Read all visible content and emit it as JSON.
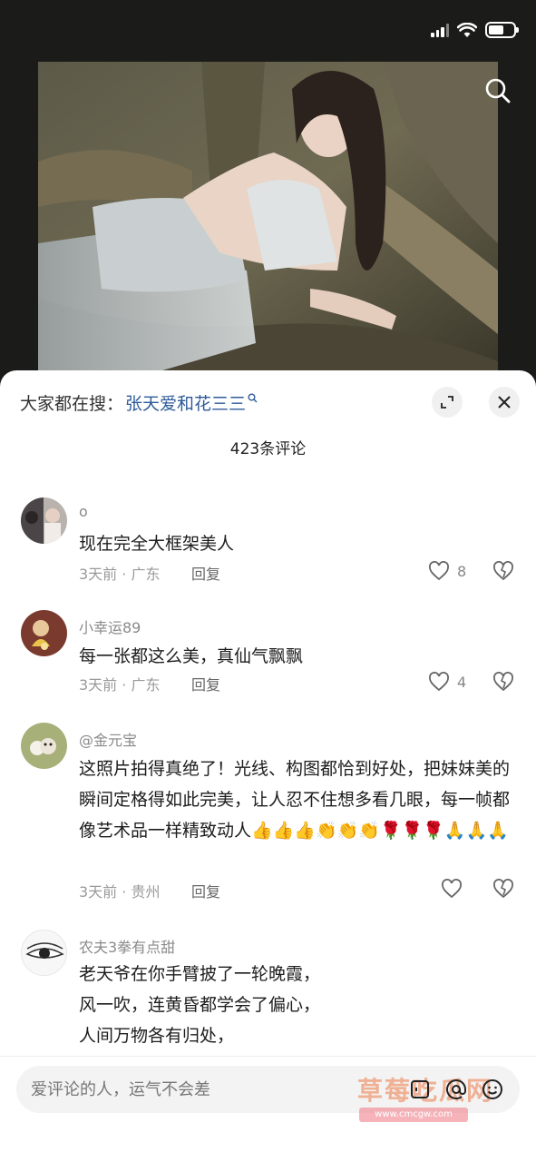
{
  "hot_search": {
    "prefix": "大家都在搜：",
    "term": "张天爱和花三三"
  },
  "comment_count": "423条评论",
  "comments": [
    {
      "username": "o",
      "text": "现在完全大框架美人",
      "meta": "3天前 · 广东",
      "reply_label": "回复",
      "likes": "8"
    },
    {
      "username": "小幸运89",
      "text": "每一张都这么美，真仙气飘飘",
      "meta": "3天前 · 广东",
      "reply_label": "回复",
      "likes": "4"
    },
    {
      "username": "@金元宝",
      "text": "这照片拍得真绝了！光线、构图都恰到好处，把妹妹美的瞬间定格得如此完美，让人忍不住想多看几眼，每一帧都像艺术品一样精致动人👍👍👍👏👏👏🌹🌹🌹🙏🙏🙏",
      "meta": "3天前 · 贵州",
      "reply_label": "回复",
      "likes": ""
    },
    {
      "username": "农夫3拳有点甜",
      "lines": [
        "老天爷在你手臂披了一轮晚霞，",
        "风一吹，连黄昏都学会了偏心，",
        "人间万物各有归处，"
      ]
    }
  ],
  "input": {
    "placeholder": "爱评论的人，运气不会差"
  },
  "watermark": {
    "text": "草莓吃瓜网",
    "url": "www.cmcgw.com"
  }
}
